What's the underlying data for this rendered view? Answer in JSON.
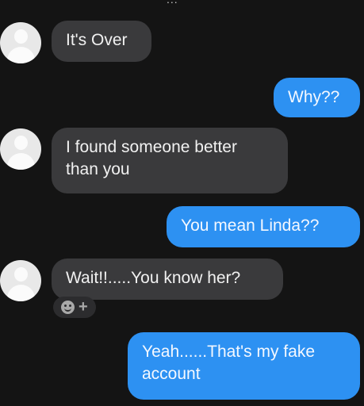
{
  "header": {
    "partial_text": "..."
  },
  "messages": [
    {
      "sender": "other",
      "text": "It's Over"
    },
    {
      "sender": "me",
      "text": "Why??"
    },
    {
      "sender": "other",
      "text": "I found someone better\nthan you"
    },
    {
      "sender": "me",
      "text": "You mean Linda??"
    },
    {
      "sender": "other",
      "text": "Wait!!.....You know her?"
    },
    {
      "sender": "me",
      "text": "Yeah......That's my fake\naccount"
    }
  ],
  "reaction_control": {
    "plus_symbol": "+",
    "icon": "smiley-icon"
  },
  "colors": {
    "background": "#141414",
    "received_bubble": "#3a3a3c",
    "sent_bubble": "#2d91f2",
    "avatar": "#e8e8e8"
  }
}
